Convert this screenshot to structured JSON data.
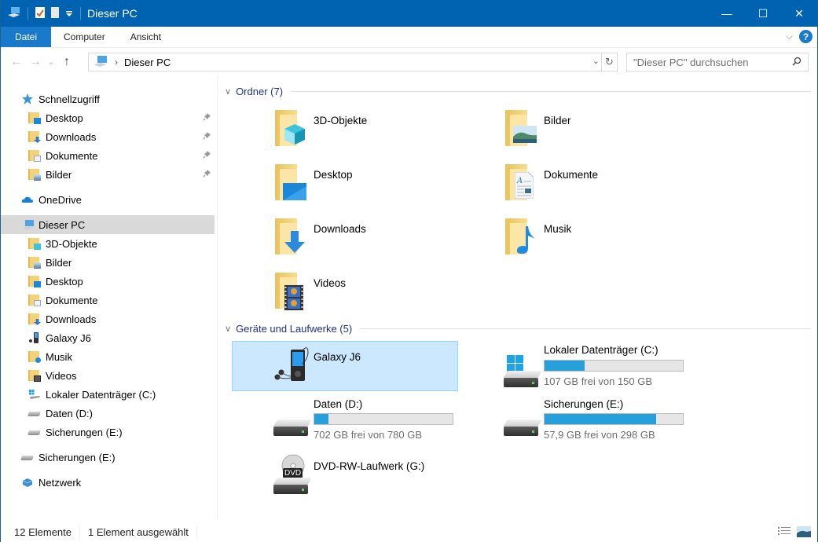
{
  "titlebar": {
    "title": "Dieser PC",
    "quick_access_icons": [
      "computer-icon",
      "properties-icon",
      "new-folder-icon",
      "customize-dropdown-icon"
    ],
    "controls": {
      "minimize": "—",
      "maximize": "☐",
      "close": "✕"
    }
  },
  "ribbon": {
    "tabs": [
      {
        "label": "Datei",
        "active": true
      },
      {
        "label": "Computer"
      },
      {
        "label": "Ansicht"
      }
    ],
    "expand_glyph": "⌵",
    "help_glyph": "?"
  },
  "navigation": {
    "back_glyph": "←",
    "forward_glyph": "→",
    "recent_glyph": "⌄",
    "up_glyph": "↑",
    "address": {
      "chevron": "›",
      "path": "Dieser PC",
      "dropdown_glyph": "⌄",
      "refresh_glyph": "↻"
    },
    "search": {
      "placeholder": "\"Dieser PC\" durchsuchen",
      "icon_glyph": "⚲"
    }
  },
  "sidebar": {
    "items": [
      {
        "label": "Schnellzugriff",
        "icon": "star-icon",
        "level": 1
      },
      {
        "label": "Desktop",
        "icon": "desktop-folder-icon",
        "level": 2,
        "pinned": true
      },
      {
        "label": "Downloads",
        "icon": "downloads-folder-icon",
        "level": 2,
        "pinned": true
      },
      {
        "label": "Dokumente",
        "icon": "documents-folder-icon",
        "level": 2,
        "pinned": true
      },
      {
        "label": "Bilder",
        "icon": "pictures-folder-icon",
        "level": 2,
        "pinned": true
      },
      {
        "label": "OneDrive",
        "icon": "onedrive-cloud-icon",
        "level": 1
      },
      {
        "label": "Dieser PC",
        "icon": "computer-icon",
        "level": 1,
        "selected": true
      },
      {
        "label": "3D-Objekte",
        "icon": "3d-objects-folder-icon",
        "level": 2
      },
      {
        "label": "Bilder",
        "icon": "pictures-folder-icon",
        "level": 2
      },
      {
        "label": "Desktop",
        "icon": "desktop-folder-icon",
        "level": 2
      },
      {
        "label": "Dokumente",
        "icon": "documents-folder-icon",
        "level": 2
      },
      {
        "label": "Downloads",
        "icon": "downloads-folder-icon",
        "level": 2
      },
      {
        "label": "Galaxy J6",
        "icon": "media-player-icon",
        "level": 2
      },
      {
        "label": "Musik",
        "icon": "music-folder-icon",
        "level": 2
      },
      {
        "label": "Videos",
        "icon": "videos-folder-icon",
        "level": 2
      },
      {
        "label": "Lokaler Datenträger (C:)",
        "icon": "windows-drive-icon",
        "level": 2
      },
      {
        "label": "Daten (D:)",
        "icon": "drive-icon",
        "level": 2
      },
      {
        "label": "Sicherungen (E:)",
        "icon": "drive-icon",
        "level": 2
      },
      {
        "label": "Sicherungen (E:)",
        "icon": "drive-icon",
        "level": 1
      },
      {
        "label": "Netzwerk",
        "icon": "network-icon",
        "level": 1
      }
    ],
    "pin_glyph": "📌"
  },
  "content": {
    "folders_group": {
      "header": "Ordner (7)",
      "items": [
        {
          "name": "3D-Objekte",
          "icon": "3d-objects-folder-icon"
        },
        {
          "name": "Bilder",
          "icon": "pictures-folder-icon"
        },
        {
          "name": "Desktop",
          "icon": "desktop-folder-icon"
        },
        {
          "name": "Dokumente",
          "icon": "documents-folder-icon"
        },
        {
          "name": "Downloads",
          "icon": "downloads-folder-icon"
        },
        {
          "name": "Musik",
          "icon": "music-folder-icon"
        },
        {
          "name": "Videos",
          "icon": "videos-folder-icon"
        }
      ]
    },
    "devices_group": {
      "header": "Geräte und Laufwerke (5)",
      "items": [
        {
          "name": "Galaxy J6",
          "icon": "media-player-icon",
          "selected": true
        },
        {
          "name": "Lokaler Datenträger (C:)",
          "icon": "windows-drive-icon",
          "free_text": "107 GB frei von 150 GB",
          "used_fraction": 0.287
        },
        {
          "name": "Daten (D:)",
          "icon": "drive-icon",
          "free_text": "702 GB frei von 780 GB",
          "used_fraction": 0.1
        },
        {
          "name": "Sicherungen (E:)",
          "icon": "drive-icon",
          "free_text": "57,9 GB frei von 298 GB",
          "used_fraction": 0.806
        },
        {
          "name": "DVD-RW-Laufwerk (G:)",
          "icon": "dvd-drive-icon",
          "badge": "DVD"
        }
      ]
    }
  },
  "statusbar": {
    "item_count": "12 Elemente",
    "selection": "1 Element ausgewählt"
  },
  "colors": {
    "titlebar": "#0063b1",
    "accent": "#1979ca",
    "selection_bg": "#cce8ff",
    "progress_fill": "#26a0da",
    "group_header": "#1e3287"
  }
}
